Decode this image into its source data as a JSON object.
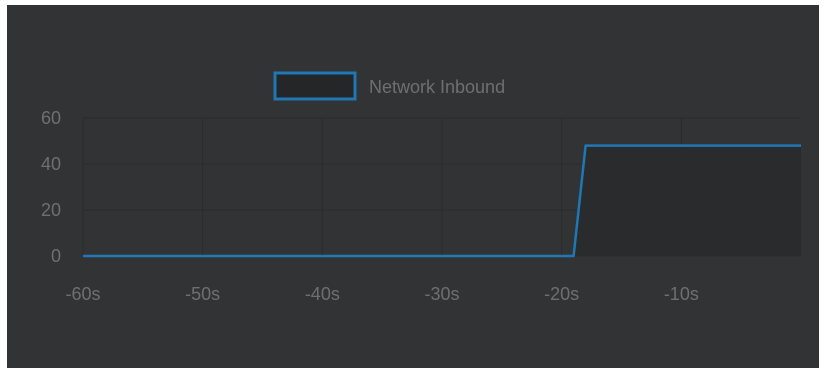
{
  "chart_data": {
    "type": "line",
    "legend": {
      "position": "top-center"
    },
    "series": [
      {
        "name": "Network Inbound",
        "color": "#1f77b4",
        "x": [
          -60,
          -19,
          -18,
          0
        ],
        "values": [
          0,
          0,
          48,
          48
        ]
      }
    ],
    "xticks": [
      "-60s",
      "-50s",
      "-40s",
      "-30s",
      "-20s",
      "-10s"
    ],
    "xtick_values": [
      -60,
      -50,
      -40,
      -30,
      -20,
      -10
    ],
    "yticks": [
      "0",
      "20",
      "40",
      "60"
    ],
    "ytick_values": [
      0,
      20,
      40,
      60
    ],
    "xlim": [
      -60,
      0
    ],
    "ylim": [
      0,
      60
    ],
    "grid": true,
    "colors": {
      "background": "#323335",
      "grid": "#2a2b2c",
      "text": "#6e6f72",
      "fill": "#2a2b2c"
    }
  }
}
